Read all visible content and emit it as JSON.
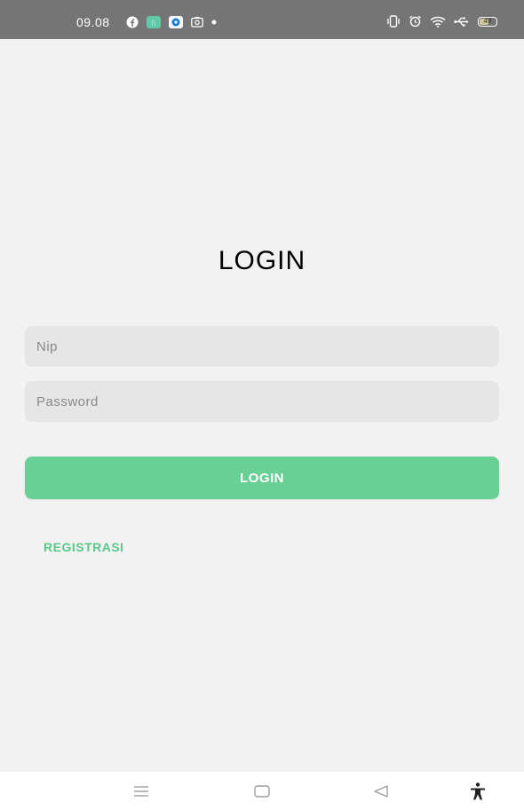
{
  "status_bar": {
    "time": "09.08",
    "notification_icons": [
      "facebook-icon",
      "app-icon",
      "messenger-icon",
      "photo-icon",
      "dot-icon"
    ],
    "system_icons": [
      "vibrate-icon",
      "alarm-icon",
      "wifi-icon",
      "usb-icon",
      "battery-icon"
    ],
    "battery_level": "49"
  },
  "login": {
    "title": "LOGIN",
    "nip_placeholder": "Nip",
    "password_placeholder": "Password",
    "button_label": "LOGIN",
    "register_label": "REGISTRASI"
  },
  "colors": {
    "status_bar": "#757575",
    "background": "#f2f2f2",
    "input_background": "#e6e6e6",
    "accent_green": "#69d095",
    "link_green": "#5cc78a"
  },
  "nav_bar": {
    "buttons": [
      "menu-icon",
      "home-icon",
      "back-icon",
      "accessibility-icon"
    ]
  }
}
